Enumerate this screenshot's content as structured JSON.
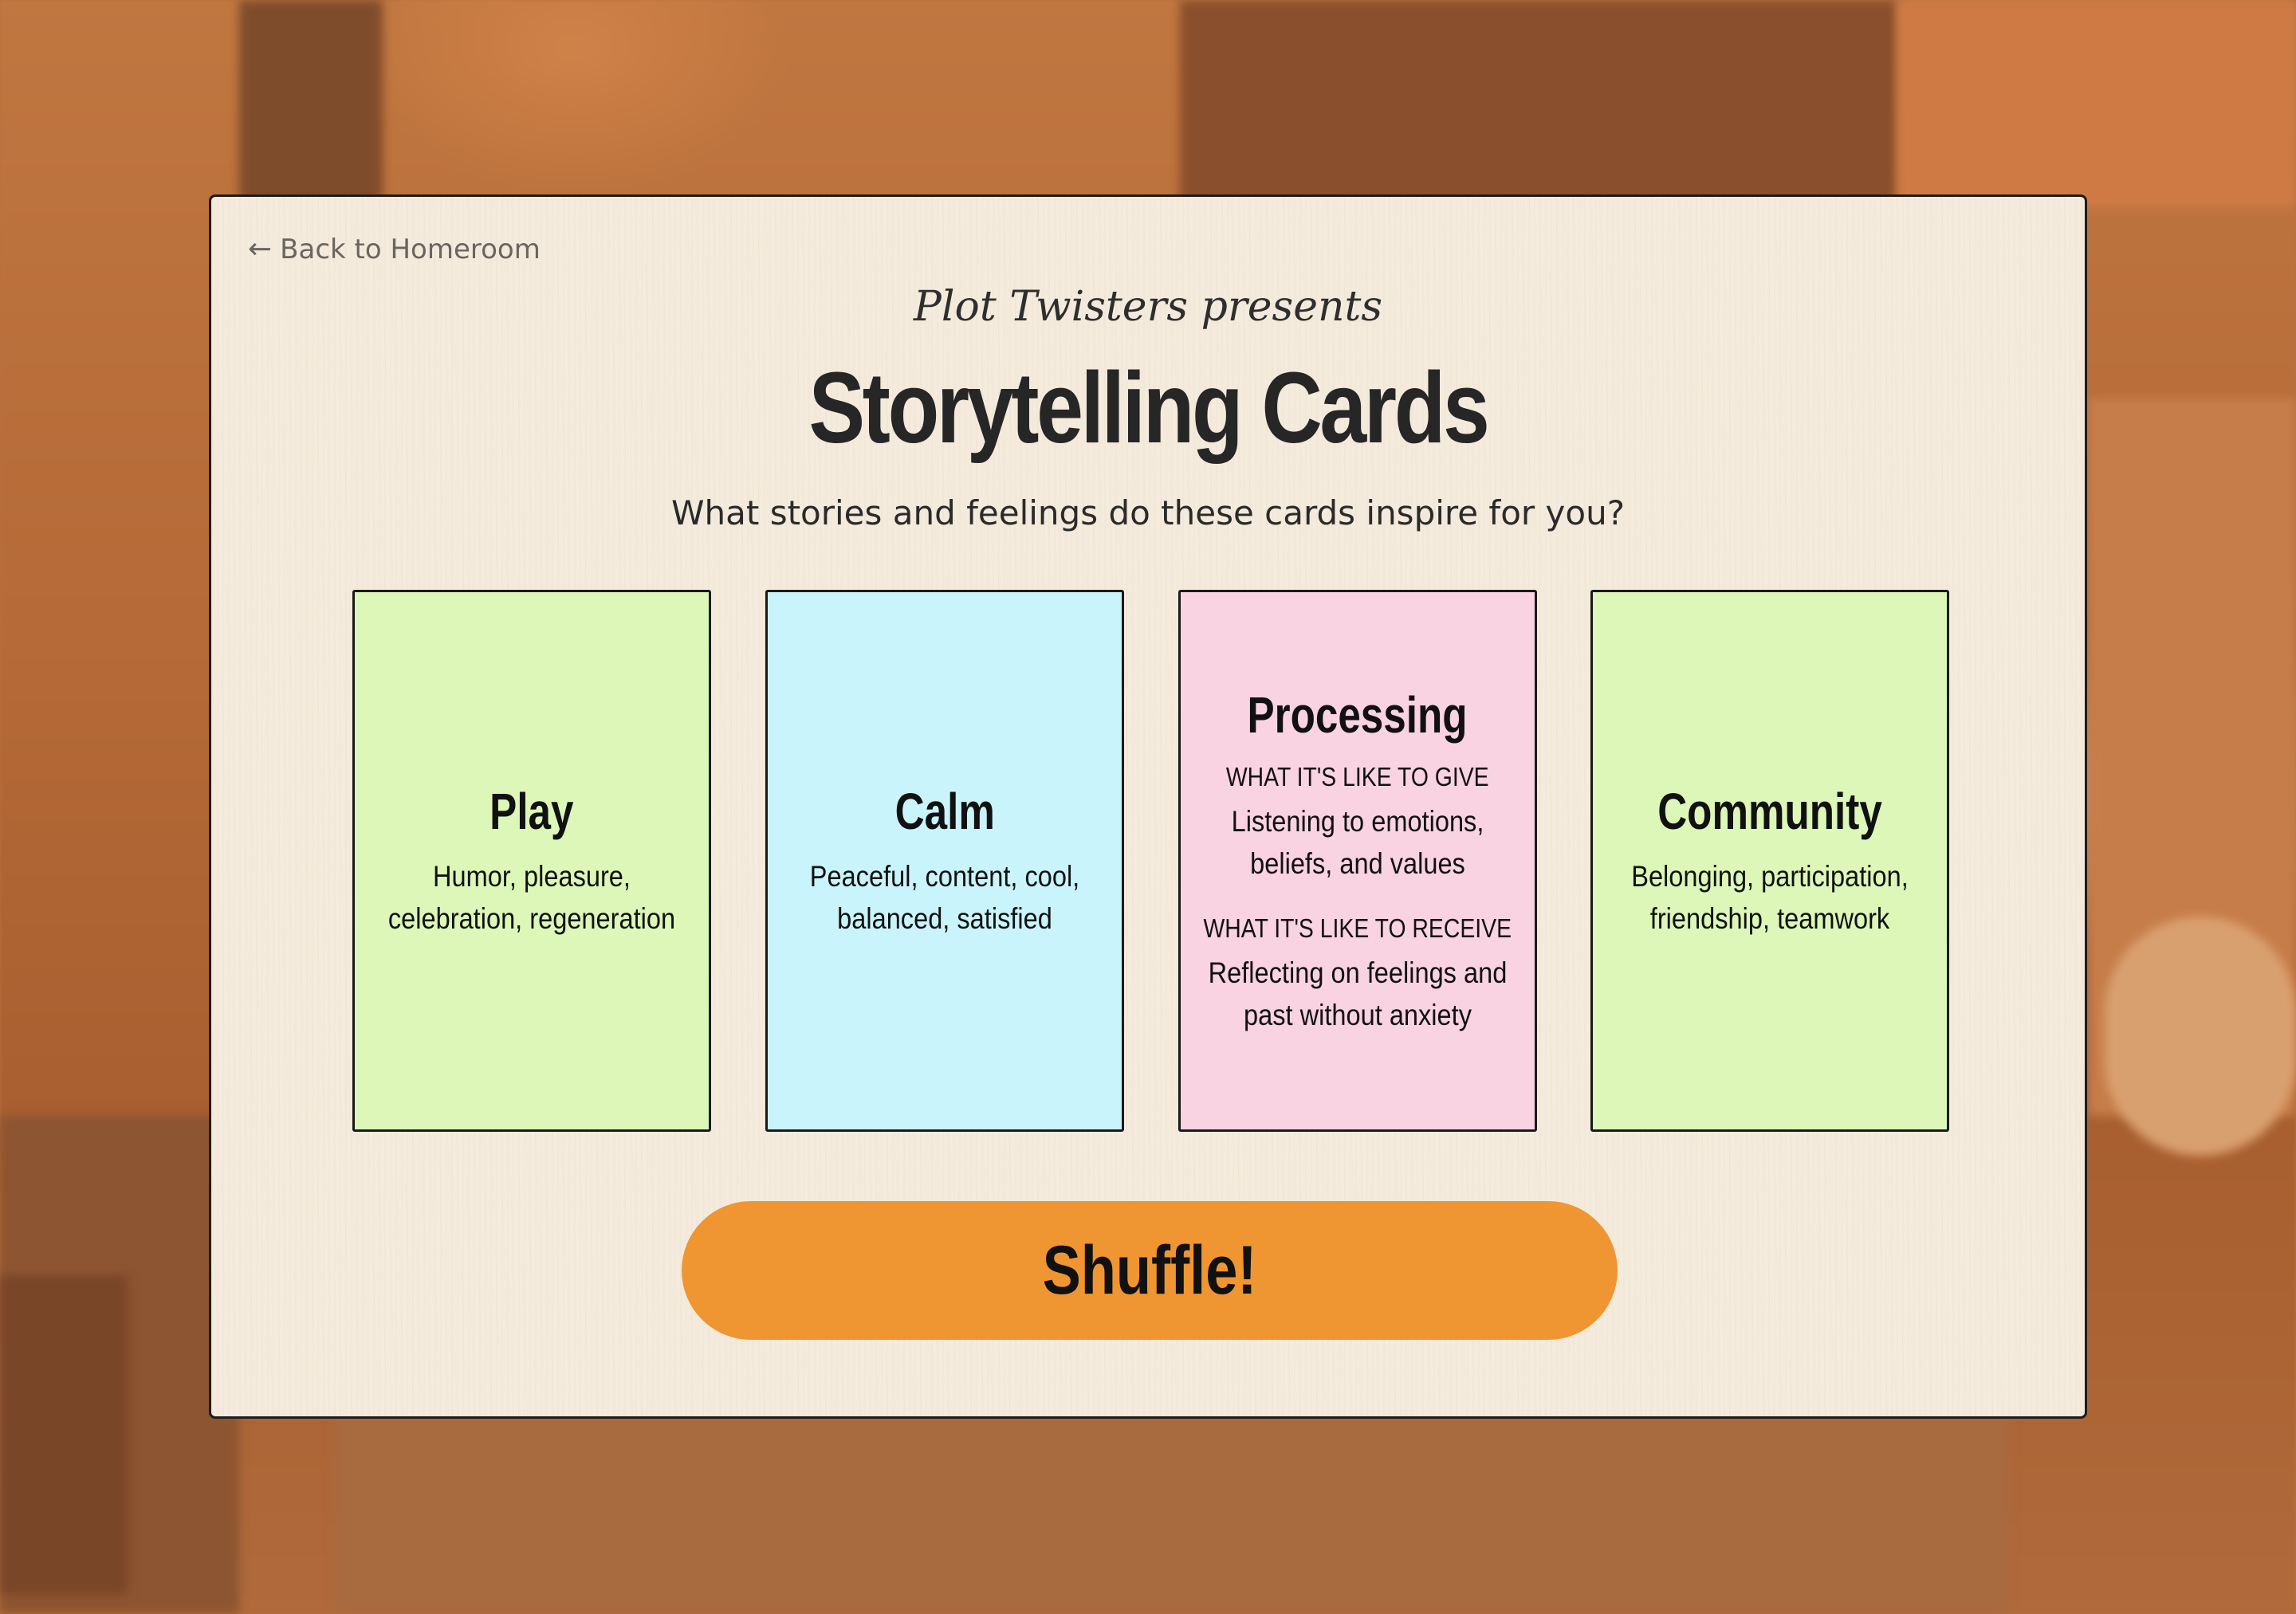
{
  "nav": {
    "back_label": "Back to Homeroom",
    "back_icon": "arrow-left-icon"
  },
  "header": {
    "presents": "Plot Twisters presents",
    "title": "Storytelling Cards",
    "subtitle": "What stories and feelings do these cards inspire for you?"
  },
  "cards": [
    {
      "title": "Play",
      "description": "Humor, pleasure, celebration, regeneration",
      "color": "#dcf7b8"
    },
    {
      "title": "Calm",
      "description": "Peaceful, content, cool, balanced, satisfied",
      "color": "#caf4fb"
    },
    {
      "title": "Processing",
      "give_label": "WHAT IT'S LIKE TO GIVE",
      "give_text": "Listening to emotions, beliefs, and values",
      "receive_label": "WHAT IT'S LIKE TO RECEIVE",
      "receive_text": "Reflecting on feelings and past without anxiety",
      "color": "#fad3e3"
    },
    {
      "title": "Community",
      "description": "Belonging, participation, friendship, teamwork",
      "color": "#dcf7b8"
    }
  ],
  "actions": {
    "shuffle_label": "Shuffle!",
    "shuffle_color": "#ef9531"
  },
  "theme": {
    "panel_background": "#f5ebdd",
    "page_background": "#b8703e"
  }
}
